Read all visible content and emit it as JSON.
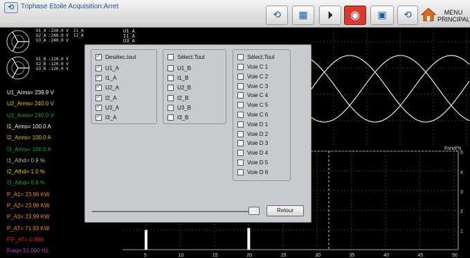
{
  "title": "Triphase Etoile Acquisition:Arret",
  "toolbar": {
    "menu_label_line1": "MENU",
    "menu_label_line2": "PRINCIPAL",
    "buttons": [
      "refresh-icon",
      "screen-icon",
      "play-icon",
      "record-icon",
      "monitor-icon",
      "refresh-icon-2"
    ]
  },
  "phasor_labels": {
    "upper_1": "U1_A :230.0 V  I1_A :100.0 A",
    "upper_2": "U2_A :240.0 V  I2_A :100.0 A",
    "upper_3": "U3_A :240.0 V",
    "lower_1": "U1_B :120.0 V",
    "lower_2": "U2_B :120.0 V",
    "lower_3": "U3_B :120.0 V",
    "right_1": "U1_A",
    "right_2": "I1_A",
    "right_3": "U3_A"
  },
  "readouts": [
    {
      "text": "U1_Arms= 239.9 V",
      "color": "#ffffff"
    },
    {
      "text": "U2_Arms= 240.0 V",
      "color": "#e6c81e"
    },
    {
      "text": "U3_Arms= 240.0 V",
      "color": "#2aa23e"
    },
    {
      "text": "I1_Arms= 100.0 A",
      "color": "#ffffff"
    },
    {
      "text": "I2_Arms= 100.0 A",
      "color": "#e6c81e"
    },
    {
      "text": "I3_Arms= 100.0 A",
      "color": "#2aa23e"
    },
    {
      "text": "I1_Athd= 0.9 %",
      "color": "#bdbdbd"
    },
    {
      "text": "I2_Athd= 1.0 %",
      "color": "#e6c81e"
    },
    {
      "text": "I3_Athd= 0.8 %",
      "color": "#2aa23e"
    },
    {
      "text": "P_A1= 23.96 KW",
      "color": "#f08a25"
    },
    {
      "text": "P_A2= 23.98 KW",
      "color": "#f08a25"
    },
    {
      "text": "P_A3= 23.99 KW",
      "color": "#f08a25"
    },
    {
      "text": "P_AT= 71.93 KW",
      "color": "#f08a25"
    },
    {
      "text": "P.F_AT= 0.999",
      "color": "#e0283a"
    },
    {
      "text": "Freq= 51.000 Hz",
      "color": "#b04ac0"
    }
  ],
  "dialog": {
    "group1": {
      "header": "Desélec.tout",
      "items": [
        {
          "label": "U1_A",
          "checked": true
        },
        {
          "label": "I1_A",
          "checked": true
        },
        {
          "label": "U2_A",
          "checked": true
        },
        {
          "label": "I2_A",
          "checked": true
        },
        {
          "label": "U3_A",
          "checked": true
        },
        {
          "label": "I3_A",
          "checked": true
        }
      ]
    },
    "group2": {
      "header": "Sélect.Tout",
      "items": [
        {
          "label": "U1_B",
          "checked": false
        },
        {
          "label": "I1_B",
          "checked": false
        },
        {
          "label": "U2_B",
          "checked": false
        },
        {
          "label": "I2_B",
          "checked": false
        },
        {
          "label": "U3_B",
          "checked": false
        },
        {
          "label": "I3_B",
          "checked": false
        }
      ]
    },
    "group3": {
      "header": "Sélect.Tout",
      "items": [
        {
          "label": "Voie C 1",
          "checked": false
        },
        {
          "label": "Voie C 2",
          "checked": false
        },
        {
          "label": "Voie C 3",
          "checked": false
        },
        {
          "label": "Voie C 4",
          "checked": false
        },
        {
          "label": "Voie C 5",
          "checked": false
        },
        {
          "label": "Voie C 6",
          "checked": false
        },
        {
          "label": "Voie D 1",
          "checked": false
        },
        {
          "label": "Voie D 2",
          "checked": false
        },
        {
          "label": "Voie D 3",
          "checked": false
        },
        {
          "label": "Voie D 4",
          "checked": false
        },
        {
          "label": "Voie D 5",
          "checked": false
        },
        {
          "label": "Voie D 6",
          "checked": false
        }
      ]
    },
    "slider_value": 0.98,
    "retour_label": "Retour"
  },
  "spectrum": {
    "ylabel": "Fond(%",
    "y_ticks": [
      "5",
      "4",
      "3",
      "2",
      "1"
    ],
    "x_ticks": [
      "5",
      "10",
      "15",
      "20",
      "25",
      "30",
      "35",
      "40",
      "45",
      "50"
    ],
    "bars": [
      {
        "harmonic": 5,
        "value": 1.0
      },
      {
        "harmonic": 20,
        "value": 1.1
      }
    ]
  },
  "colors": {
    "wave_color": "#ffffff",
    "grid_color": "#3a3a3a",
    "dialog_bg": "#c7cbcf"
  }
}
